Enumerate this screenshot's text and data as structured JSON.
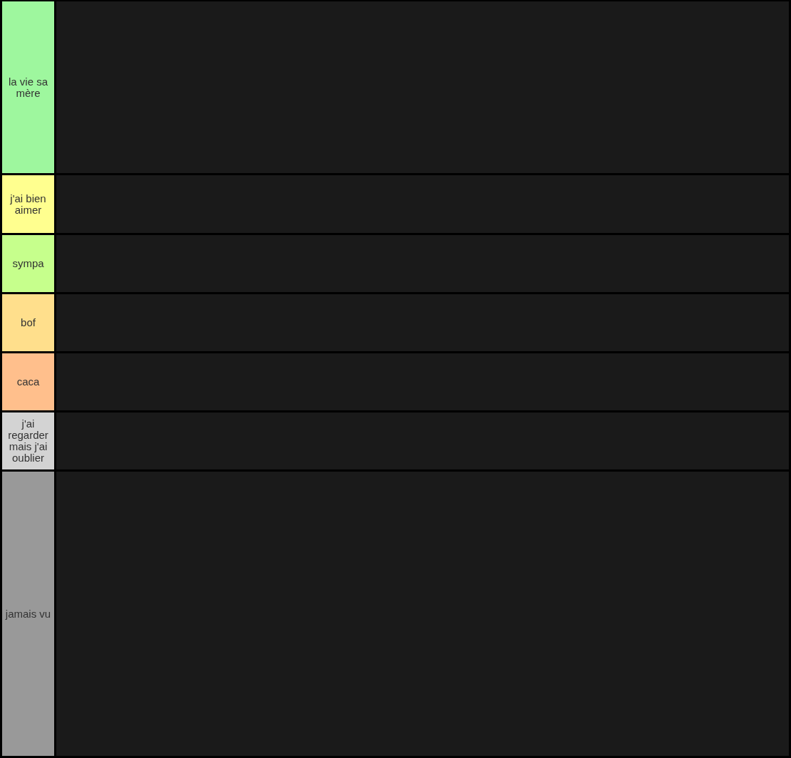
{
  "tiers": [
    {
      "label": "la vie sa mère",
      "color": "#9ef79e"
    },
    {
      "label": "j'ai bien aimer",
      "color": "#ffff8f"
    },
    {
      "label": "sympa",
      "color": "#c6ff8c"
    },
    {
      "label": "bof",
      "color": "#ffdf8c"
    },
    {
      "label": "caca",
      "color": "#ffbf8c"
    },
    {
      "label": "j'ai regarder mais j'ai oublier",
      "color": "#d3d3d3"
    },
    {
      "label": "jamais vu",
      "color": "#999999"
    }
  ]
}
